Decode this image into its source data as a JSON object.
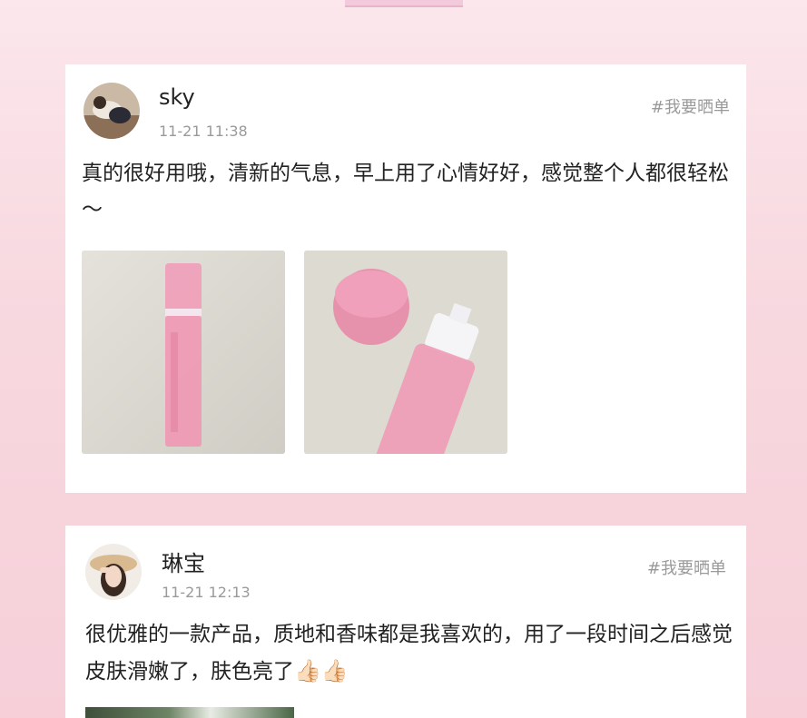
{
  "posts": [
    {
      "username": "sky",
      "time": "11-21 11:38",
      "tag": "#我要晒单",
      "content": "真的很好用哦，清新的气息，早上用了心情好好，感觉整个人都很轻松～",
      "images": [
        "pink-spray-bottle-photo",
        "pink-bottle-cap-photo"
      ]
    },
    {
      "username": "琳宝",
      "time": "11-21 12:13",
      "tag": "#我要晒单",
      "content": "很优雅的一款产品，质地和香味都是我喜欢的，用了一段时间之后感觉皮肤滑嫩了，肤色亮了",
      "emoji": "👍🏻👍🏻"
    }
  ]
}
